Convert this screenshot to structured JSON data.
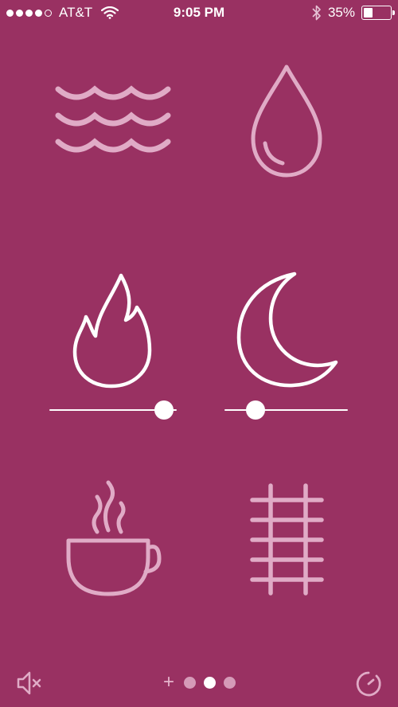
{
  "status_bar": {
    "carrier": "AT&T",
    "signal_bars_filled": 4,
    "signal_bars_total": 5,
    "time": "9:05 PM",
    "battery_percent_text": "35%",
    "battery_level": 0.35
  },
  "sounds": [
    {
      "name": "waves",
      "icon": "waves-icon",
      "active": false
    },
    {
      "name": "rain-drop",
      "icon": "water-drop-icon",
      "active": false
    },
    {
      "name": "fire",
      "icon": "flame-icon",
      "active": true,
      "volume": 0.9
    },
    {
      "name": "night",
      "icon": "crescent-moon-icon",
      "active": true,
      "volume": 0.25
    },
    {
      "name": "coffee",
      "icon": "coffee-cup-icon",
      "active": false
    },
    {
      "name": "train",
      "icon": "railroad-track-icon",
      "active": false
    }
  ],
  "pager": {
    "add_label": "+",
    "pages": 3,
    "active_index": 1
  },
  "colors": {
    "background": "#993162",
    "active_icon": "#ffffff",
    "inactive_icon": "#e0abc6",
    "inactive_dot": "#d59bb8"
  }
}
